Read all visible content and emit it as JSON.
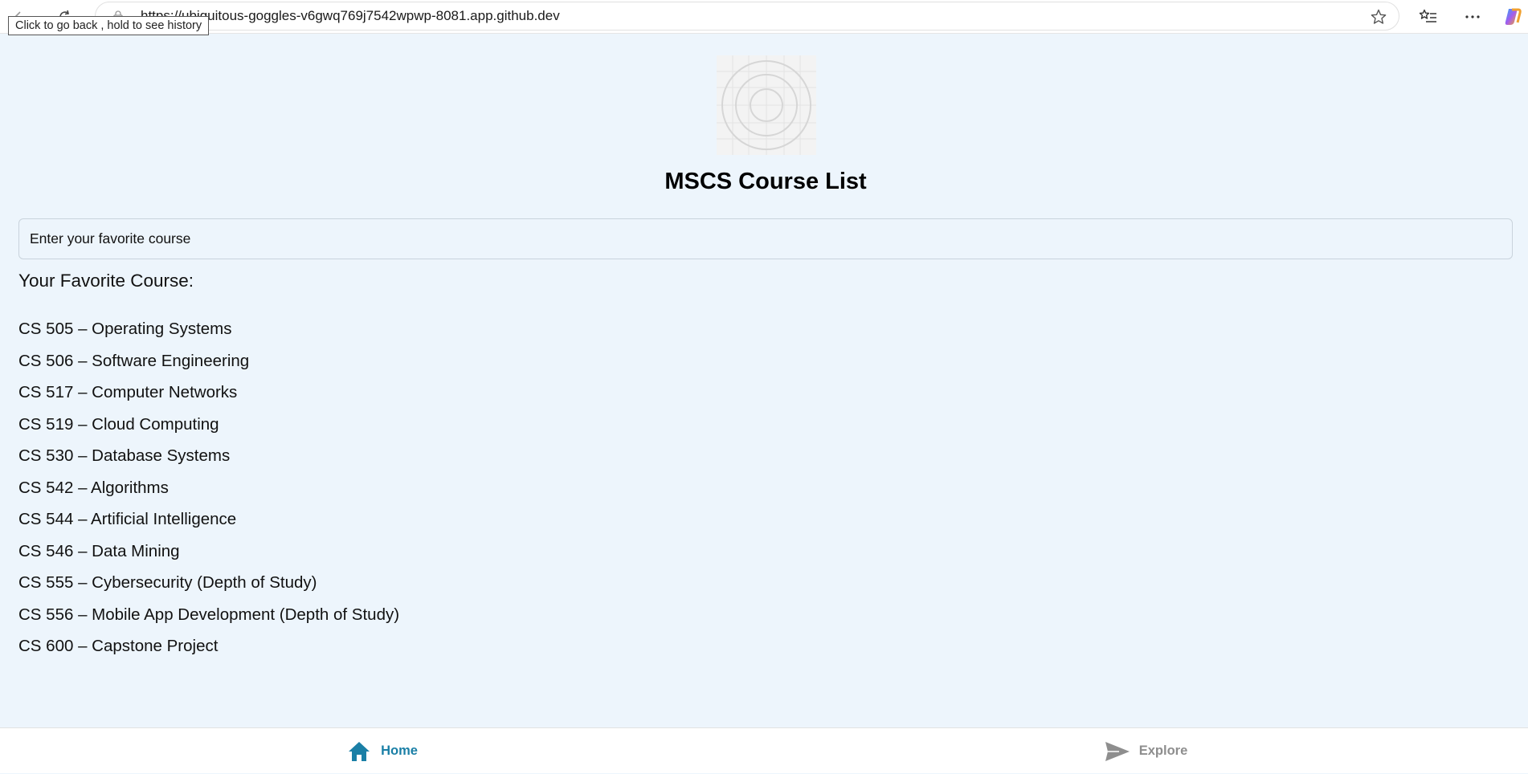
{
  "browser": {
    "url": "https://ubiquitous-goggles-v6gwq769j7542wpwp-8081.app.github.dev",
    "tooltip": "Click to go back , hold to see history"
  },
  "app": {
    "title": "MSCS Course List",
    "input": {
      "value": "",
      "placeholder": "Enter your favorite course"
    },
    "favorite_label": "Your Favorite Course:",
    "favorite_value": "",
    "courses": [
      "CS 505 – Operating Systems",
      "CS 506 – Software Engineering",
      "CS 517 – Computer Networks",
      "CS 519 – Cloud Computing",
      "CS 530 – Database Systems",
      "CS 542 – Algorithms",
      "CS 544 – Artificial Intelligence",
      "CS 546 – Data Mining",
      "CS 555 – Cybersecurity (Depth of Study)",
      "CS 556 – Mobile App Development (Depth of Study)",
      "CS 600 – Capstone Project"
    ]
  },
  "tabs": {
    "home": {
      "label": "Home",
      "icon": "home-icon",
      "active": true,
      "color": "#1a7fa6"
    },
    "explore": {
      "label": "Explore",
      "icon": "paper-plane-icon",
      "active": false,
      "color": "#8e8e8e"
    }
  },
  "colors": {
    "background": "#edf5fc",
    "accent": "#1a7fa6"
  }
}
